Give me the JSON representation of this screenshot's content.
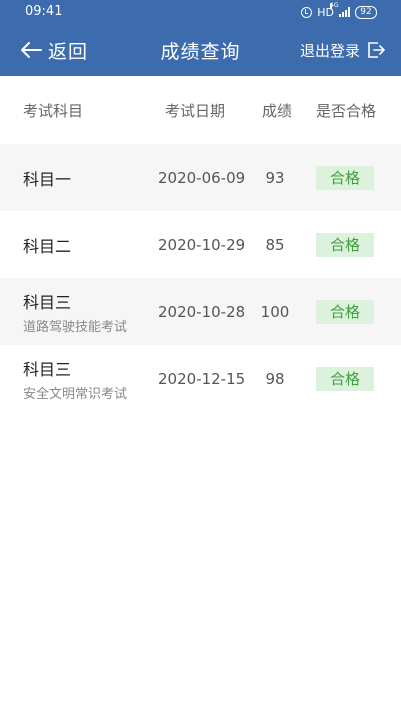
{
  "status_bar": {
    "time": "09:41",
    "hd": "HD",
    "network": "4G",
    "battery": "92",
    "icons": [
      "alarm-icon",
      "signal-icon",
      "battery-icon"
    ]
  },
  "nav": {
    "back_label": "返回",
    "title": "成绩查询",
    "logout_label": "退出登录"
  },
  "table": {
    "headers": {
      "subject": "考试科目",
      "date": "考试日期",
      "score": "成绩",
      "pass": "是否合格"
    },
    "rows": [
      {
        "subject": "科目一",
        "subtitle": "",
        "date": "2020-06-09",
        "score": "93",
        "pass": "合格"
      },
      {
        "subject": "科目二",
        "subtitle": "",
        "date": "2020-10-29",
        "score": "85",
        "pass": "合格"
      },
      {
        "subject": "科目三",
        "subtitle": "道路驾驶技能考试",
        "date": "2020-10-28",
        "score": "100",
        "pass": "合格"
      },
      {
        "subject": "科目三",
        "subtitle": "安全文明常识考试",
        "date": "2020-12-15",
        "score": "98",
        "pass": "合格"
      }
    ]
  },
  "colors": {
    "header_bg": "#3c6cad",
    "row_shade": "#f6f6f6",
    "pass_bg": "#dcf2dc",
    "pass_text": "#3fa03f"
  }
}
